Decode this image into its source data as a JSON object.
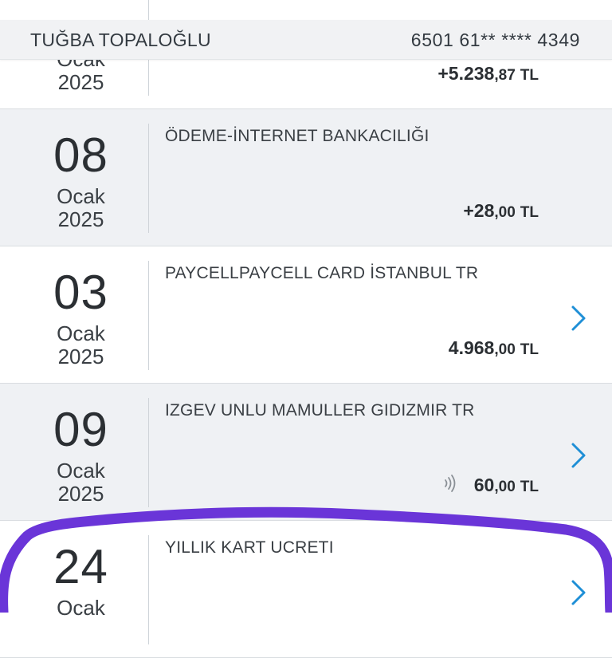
{
  "header": {
    "card_holder": "TUĞBA TOPALOĞLU",
    "card_number": "6501 61** **** 4349"
  },
  "transactions": [
    {
      "day": "",
      "month": "Ocak",
      "year": "2025",
      "description": "",
      "amount_main": "+5.238",
      "amount_decimal": ",87",
      "currency": "TL",
      "has_detail": false
    },
    {
      "day": "08",
      "month": "Ocak",
      "year": "2025",
      "description": "ÖDEME-İNTERNET BANKACILIĞI",
      "amount_main": "+28",
      "amount_decimal": ",00",
      "currency": "TL",
      "has_detail": false
    },
    {
      "day": "03",
      "month": "Ocak",
      "year": "2025",
      "description": "PAYCELLPAYCELL CARD İSTANBUL TR",
      "amount_main": "4.968",
      "amount_decimal": ",00",
      "currency": "TL",
      "has_detail": true
    },
    {
      "day": "09",
      "month": "Ocak",
      "year": "2025",
      "description": "IZGEV UNLU MAMULLER GIDIZMIR TR",
      "amount_main": "60",
      "amount_decimal": ",00",
      "currency": "TL",
      "has_detail": true,
      "icon": "contactless-icon"
    },
    {
      "day": "24",
      "month": "Ocak",
      "year": "",
      "description": "YILLIK KART UCRETI",
      "amount_main": "",
      "amount_decimal": "",
      "currency": "",
      "has_detail": true
    }
  ],
  "colors": {
    "accent": "#1f8fd6",
    "highlight": "#6a35d8",
    "row_grey": "#eff1f4"
  }
}
